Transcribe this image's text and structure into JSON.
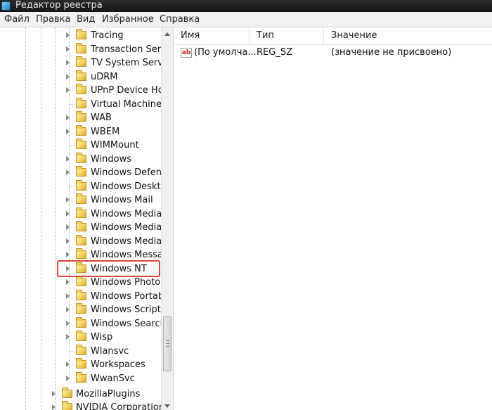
{
  "window": {
    "title": "Редактор реестра"
  },
  "menu": [
    "Файл",
    "Правка",
    "Вид",
    "Избранное",
    "Справка"
  ],
  "tree": [
    {
      "label": "Tracing",
      "expandable": true
    },
    {
      "label": "Transaction Serve",
      "expandable": true
    },
    {
      "label": "TV System Servic",
      "expandable": true
    },
    {
      "label": "uDRM",
      "expandable": true
    },
    {
      "label": "UPnP Device Hos",
      "expandable": true
    },
    {
      "label": "Virtual Machine",
      "expandable": false
    },
    {
      "label": "WAB",
      "expandable": true
    },
    {
      "label": "WBEM",
      "expandable": true
    },
    {
      "label": "WIMMount",
      "expandable": false
    },
    {
      "label": "Windows",
      "expandable": true
    },
    {
      "label": "Windows Defenc",
      "expandable": true
    },
    {
      "label": "Windows Deskto",
      "expandable": false
    },
    {
      "label": "Windows Mail",
      "expandable": true
    },
    {
      "label": "Windows Media",
      "expandable": true
    },
    {
      "label": "Windows Media",
      "expandable": true
    },
    {
      "label": "Windows Media",
      "expandable": true
    },
    {
      "label": "Windows Messac",
      "expandable": true
    },
    {
      "label": "Windows NT",
      "expandable": true,
      "highlighted": true
    },
    {
      "label": "Windows Photo V",
      "expandable": true
    },
    {
      "label": "Windows Portab",
      "expandable": true
    },
    {
      "label": "Windows Script I",
      "expandable": true
    },
    {
      "label": "Windows Search",
      "expandable": true
    },
    {
      "label": "Wisp",
      "expandable": true
    },
    {
      "label": "Wlansvc",
      "expandable": false
    },
    {
      "label": "Workspaces",
      "expandable": true
    },
    {
      "label": "WwanSvc",
      "expandable": true
    }
  ],
  "tree_parent": [
    {
      "label": "MozillaPlugins",
      "expandable": true
    },
    {
      "label": "NVIDIA Corporation",
      "expandable": true
    }
  ],
  "values_table": {
    "columns": [
      "Имя",
      "Тип",
      "Значение"
    ],
    "rows": [
      {
        "icon": "string-value-icon",
        "icon_text": "ab",
        "name": "(По умолча...",
        "type": "REG_SZ",
        "value": "(значение не присвоено)"
      }
    ]
  },
  "colors": {
    "highlight_border": "#d9453b",
    "folder": "#f2d25e"
  }
}
